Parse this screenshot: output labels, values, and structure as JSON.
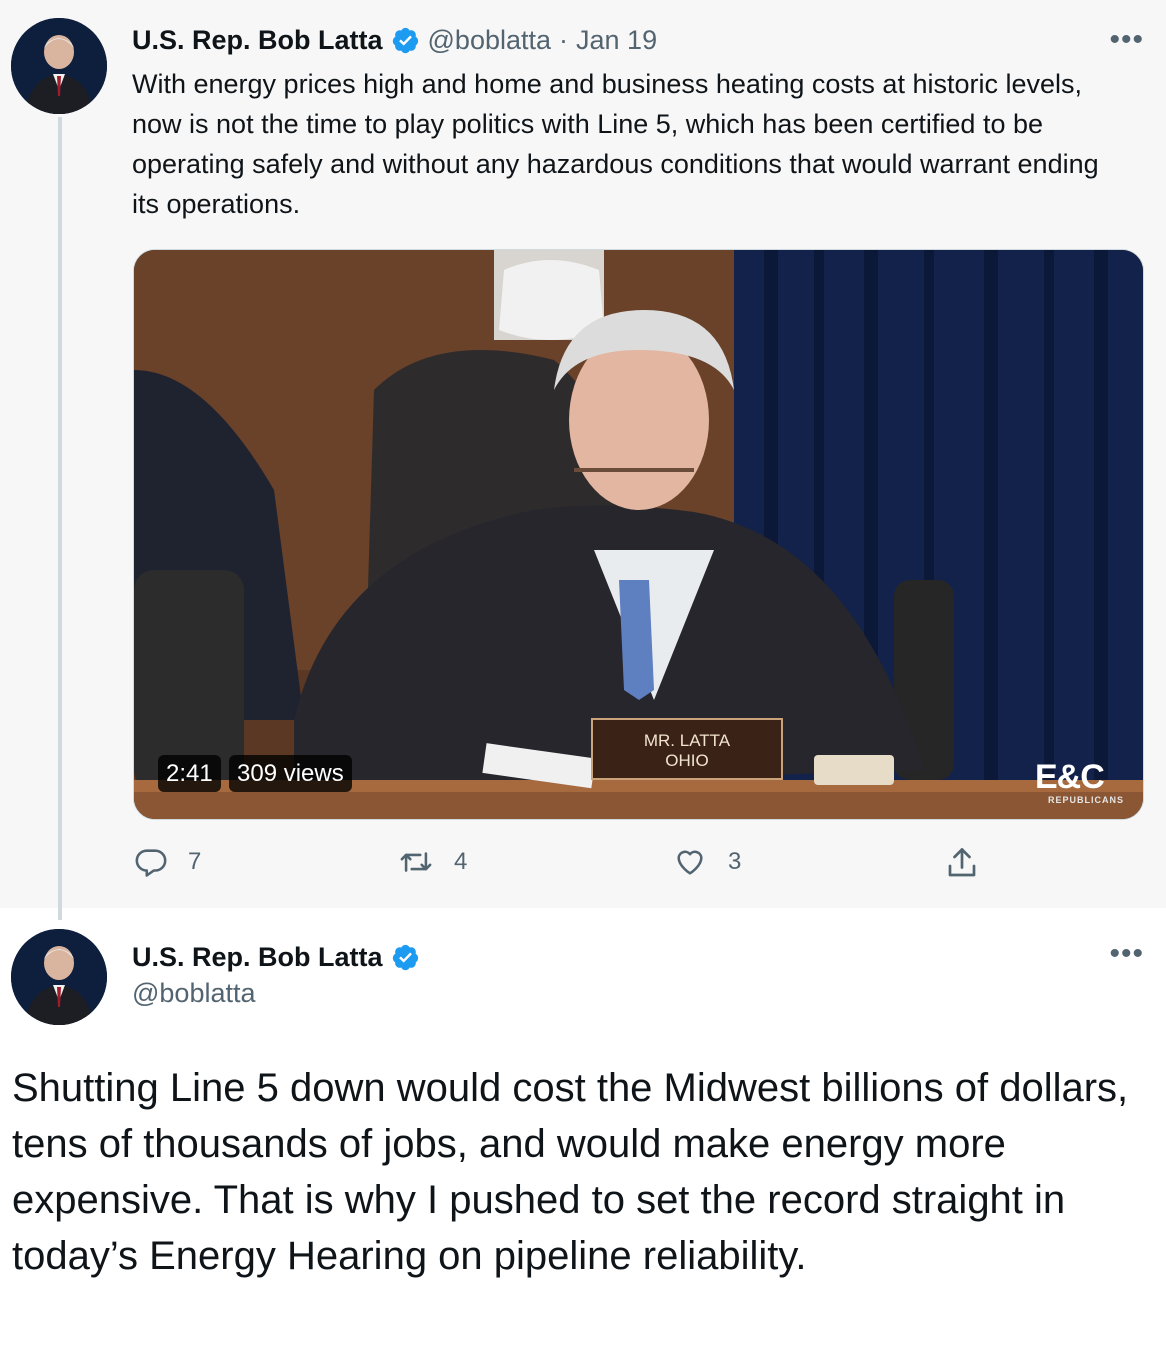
{
  "parent_tweet": {
    "author_name": "U.S. Rep. Bob Latta",
    "handle": "@boblatta",
    "separator": "·",
    "date": "Jan 19",
    "more": "•••",
    "text": "With energy prices high and home and business heating costs at historic levels, now is not the time to play politics with Line 5, which has been certified to be operating safely and without any hazardous conditions that would warrant ending its operations.",
    "video": {
      "duration": "2:41",
      "views": "309 views",
      "nameplate_line1": "MR. LATTA",
      "nameplate_line2": "OHIO",
      "logo_text": "E&C",
      "logo_subtext": "REPUBLICANS"
    },
    "actions": {
      "replies": "7",
      "retweets": "4",
      "likes": "3"
    }
  },
  "main_tweet": {
    "author_name": "U.S. Rep. Bob Latta",
    "handle": "@boblatta",
    "more": "•••",
    "text": "Shutting Line 5 down would cost the Midwest billions of dollars, tens of thousands of jobs, and would make energy more expensive. That is why I pushed to set the record straight in today’s Energy Hearing on pipeline reliability."
  },
  "colors": {
    "verified_blue": "#1d9bf0",
    "secondary_text": "#536471",
    "parent_background": "#f7f7f7"
  },
  "icons": [
    "verified-badge-icon",
    "reply-icon",
    "retweet-icon",
    "like-icon",
    "share-icon",
    "more-icon"
  ]
}
